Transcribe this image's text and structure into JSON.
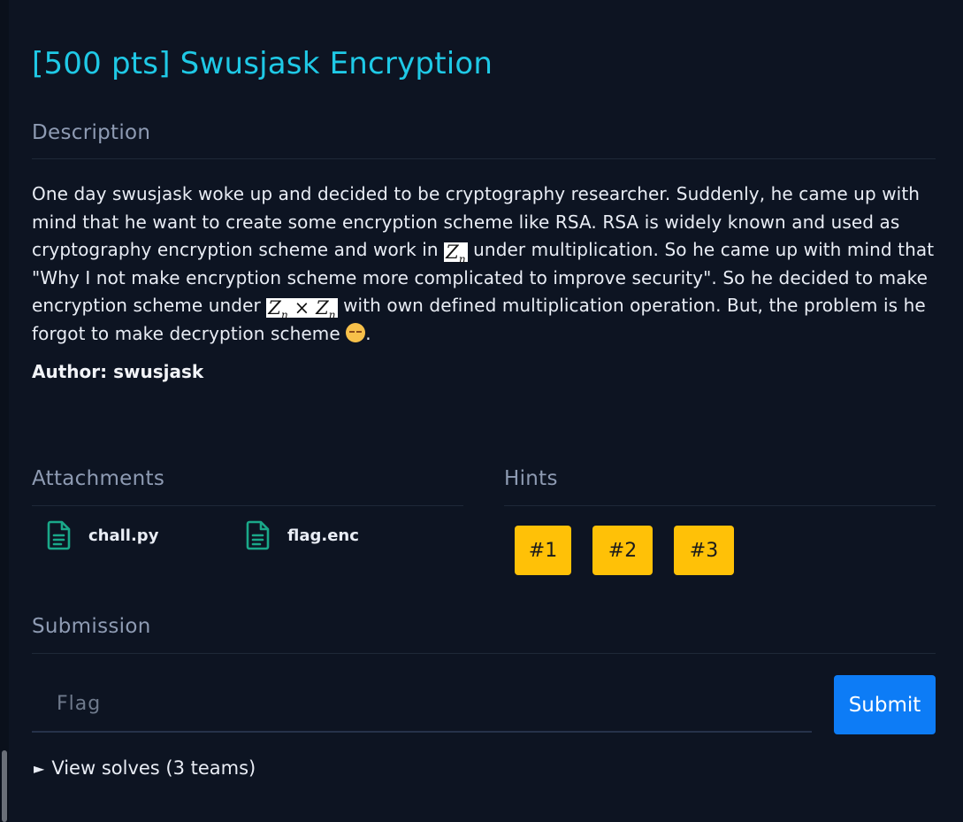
{
  "challenge": {
    "title": "[500 pts] Swusjask Encryption"
  },
  "description": {
    "heading": "Description",
    "seg1": "One day swusjask woke up and decided to be cryptography researcher. Suddenly, he came up with mind that he want to create some encryption scheme like RSA. RSA is widely known and used as cryptography encryption scheme and work in ",
    "math1_base": "Z",
    "math1_sub": "n",
    "seg2": " under multiplication. So he came up with mind that \"Why I not make encryption scheme more complicated to improve security\". So he decided to make encryption scheme under ",
    "math2_base_a": "Z",
    "math2_sub_a": "n",
    "math2_op": " × ",
    "math2_base_b": "Z",
    "math2_sub_b": "n",
    "seg3": " with own defined multiplication operation. But, the problem is he forgot to make decryption scheme ",
    "emoji": "pensive-face-emoji",
    "seg4": "."
  },
  "author": {
    "text": "Author: swusjask"
  },
  "attachments": {
    "heading": "Attachments",
    "files": [
      {
        "name": "chall.py",
        "icon": "file-text-icon"
      },
      {
        "name": "flag.enc",
        "icon": "file-text-icon"
      }
    ]
  },
  "hints": {
    "heading": "Hints",
    "items": [
      "#1",
      "#2",
      "#3"
    ],
    "color": "#ffc107"
  },
  "submission": {
    "heading": "Submission",
    "placeholder": "Flag",
    "submit_label": "Submit",
    "solves_label": "View solves (3 teams)",
    "solves_icon": "►"
  },
  "colors": {
    "background": "#0d1422",
    "title": "#1fc9e6",
    "accent": "#0d7cf6",
    "icon": "#1aa889"
  }
}
